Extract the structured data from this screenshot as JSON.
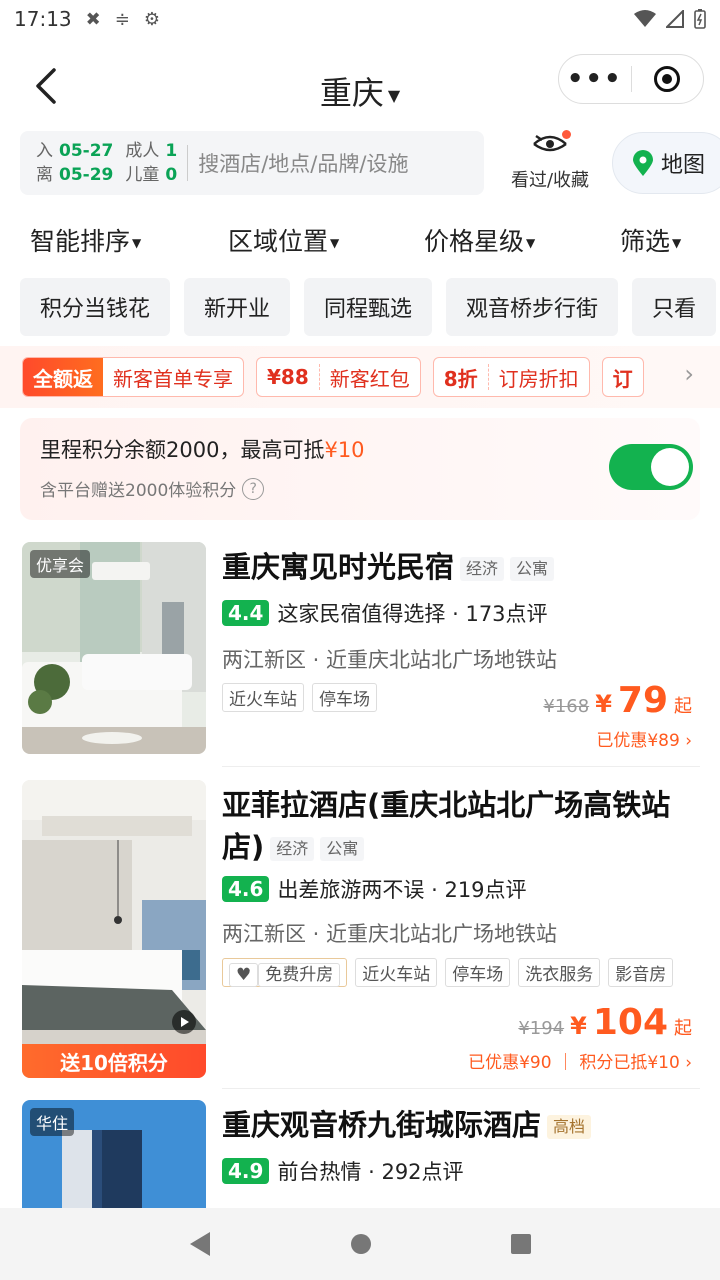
{
  "status": {
    "time": "17:13"
  },
  "header": {
    "title": "重庆"
  },
  "search": {
    "checkin_label": "入",
    "checkin_date": "05-27",
    "checkout_label": "离",
    "checkout_date": "05-29",
    "adults_label": "成人",
    "adults": "1",
    "children_label": "儿童",
    "children": "0",
    "placeholder": "搜酒店/地点/品牌/设施",
    "history_label": "看过/收藏",
    "map_label": "地图"
  },
  "sort": [
    "智能排序",
    "区域位置",
    "价格星级",
    "筛选"
  ],
  "chips": [
    "积分当钱花",
    "新开业",
    "同程甄选",
    "观音桥步行街",
    "只看"
  ],
  "coupons": [
    {
      "tag": "全额返",
      "text": "新客首单专享"
    },
    {
      "tag": "¥88",
      "text": "新客红包"
    },
    {
      "tag": "8折",
      "text": "订房折扣"
    },
    {
      "tag": "订",
      "text": ""
    }
  ],
  "points": {
    "text": "里程积分余额2000，最高可抵",
    "amount": "¥10",
    "sub": "含平台赠送2000体验积分"
  },
  "hotels": [
    {
      "badge": "优享会",
      "name": "重庆寓见时光民宿",
      "tags": [
        "经济",
        "公寓"
      ],
      "score": "4.4",
      "review": "这家民宿值得选择 · 173点评",
      "location": "两江新区 · 近重庆北站北广场地铁站",
      "amenities": [
        "近火车站",
        "停车场"
      ],
      "orig_price": "¥168",
      "currency": "¥",
      "price": "79",
      "price_suffix": "起",
      "discount": "已优惠¥89 ›"
    },
    {
      "name_line1": "亚菲拉酒店(重庆北站北广场高铁站",
      "name_line2": "店)",
      "tags": [
        "经济",
        "公寓"
      ],
      "score": "4.6",
      "review": "出差旅游两不误 · 219点评",
      "location": "两江新区 · 近重庆北站北广场地铁站",
      "upgrade": "免费升房",
      "amenities": [
        "近火车站",
        "停车场",
        "洗衣服务",
        "影音房"
      ],
      "orig_price": "¥194",
      "currency": "¥",
      "price": "104",
      "price_suffix": "起",
      "discount": "已优惠¥90 ｜ 积分已抵¥10 ›",
      "banner": "送10倍积分"
    },
    {
      "badge": "华住",
      "name": "重庆观音桥九街城际酒店",
      "tags": [
        "高档"
      ],
      "score": "4.9",
      "review": "前台热情 · 292点评"
    }
  ]
}
